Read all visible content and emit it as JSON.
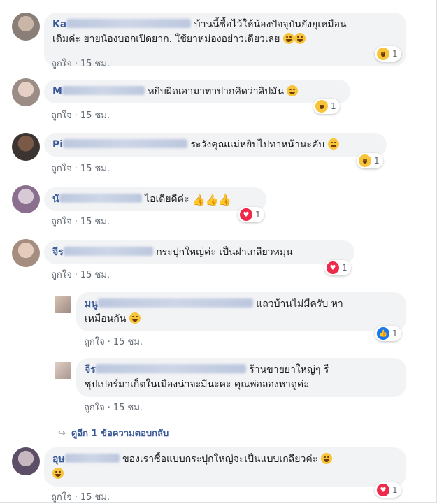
{
  "like_label": "ถูกใจ",
  "time_label": "15 ชม.",
  "comments": [
    {
      "author_visible": "Ka",
      "text": "บ้านนี้ซื้อไว้ให้น้องปัจจุบันยังยุเหมือนเดิมค่ะ ยายน้องบอกเปิดยาก. ใช้ยาหม่องอย่าวเดียวเลย",
      "reaction": "haha",
      "count": "1"
    },
    {
      "author_visible": "M",
      "text": "หยิบผิดเอามาทาปากคิดว่าลิปมัน",
      "reaction": "haha",
      "count": "1"
    },
    {
      "author_visible": "Pi",
      "text": "ระวังคุณแม่หยิบไปทาหน้านะคับ",
      "reaction": "haha",
      "count": "1"
    },
    {
      "author_visible": "นั",
      "text": "ไอเดียดีค่ะ",
      "reaction": "love",
      "count": "1"
    },
    {
      "author_visible": "จีร",
      "text": "กระปุกใหญ่ค่ะ เป็นฝาเกลียวหมุน",
      "reaction": "love",
      "count": "1"
    },
    {
      "author_visible": "มนู",
      "text": "แถวบ้านไม่มีครับ หาเหมือนกัน",
      "reaction": "like",
      "count": "1"
    },
    {
      "author_visible": "จีร",
      "text": "ร้านขายยาใหญ่ๆ รีซุปเปอร์มาเก็ตในเมืองน่าจะมีนะคะ คุณพ่อลองหาดูค่ะ",
      "reaction": "",
      "count": ""
    },
    {
      "author_visible": "อุษ",
      "text": "ของเราซื้อแบบกระปุกใหญ่จะเป็นแบบเกลียวค่ะ",
      "reaction": "love",
      "count": "1"
    }
  ],
  "comment6_line2": "ซุปเปอร์มาเก็ตในเมืองน่าจะมีนะคะ คุณพ่อลองหาดูค่ะ",
  "comment1_line1": "บ้านนี้ซื้อไว้ให้น้องปัจจุบันยังยุเหมือน",
  "comment1_line2": "เดิมค่ะ ยายน้องบอกเปิดยาก. ใช้ยาหม่องอย่าวเดียวเลย",
  "comment5_line1": "แถวบ้านไม่มีครับ หา",
  "comment5_line2": "เหมือนกัน",
  "comment6_line1": "ร้านขายยาใหญ่ๆ รี",
  "view_replies": "ดูอีก 1 ข้อความตอบกลับ",
  "colors": {
    "link": "#385898",
    "bubble": "#f2f3f5",
    "meta": "#606770",
    "love": "#f0284a",
    "like": "#1877f2",
    "haha": "#f7c43a"
  }
}
